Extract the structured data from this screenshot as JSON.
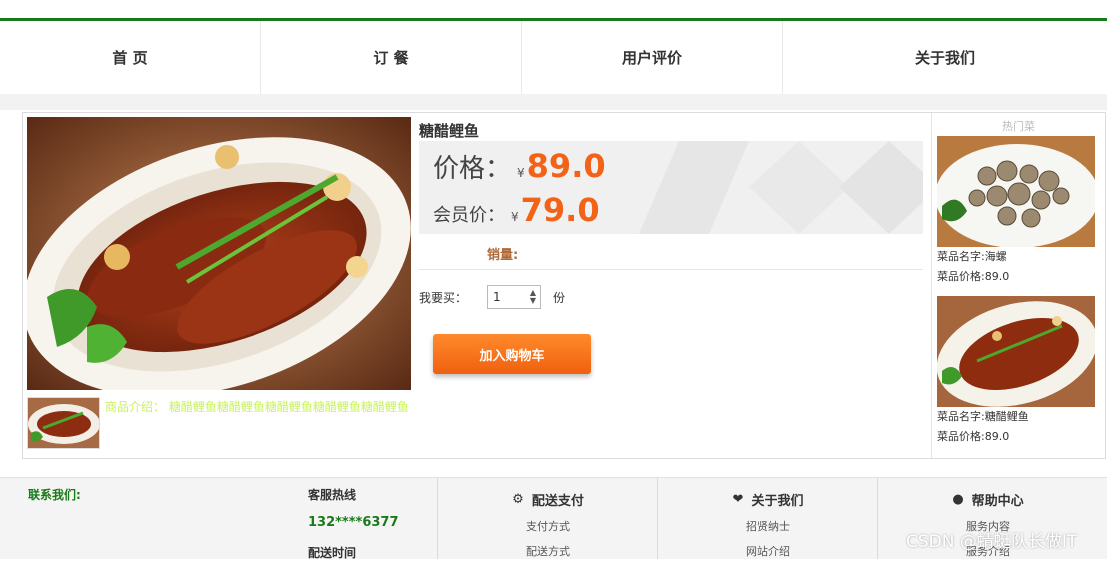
{
  "nav": {
    "items": [
      "首 页",
      "订 餐",
      "用户评价",
      "关于我们"
    ]
  },
  "product": {
    "title": "糖醋鲤鱼",
    "price_label": "价格：",
    "currency": "¥",
    "price": "89.0",
    "member_label": "会员价：",
    "member_price": "79.0",
    "sales_label": "销量:",
    "buy_label": "我要买：",
    "quantity": "1",
    "unit": "份",
    "cart_button": "加入购物车",
    "intro": "商品介绍：  糖醋鲤鱼糖醋鲤鱼糖醋鲤鱼糖醋鲤鱼糖醋鲤鱼"
  },
  "sidebar": {
    "title": "热门菜",
    "items": [
      {
        "name": "菜品名字:海螺",
        "price": "菜品价格:89.0"
      },
      {
        "name": "菜品名字:糖醋鲤鱼",
        "price": "菜品价格:89.0"
      }
    ]
  },
  "footer": {
    "contact": "联系我们:",
    "hotline_label": "客服热线",
    "hotline": "132****6377",
    "delivery_time": "配送时间",
    "col1": {
      "title": "配送支付",
      "links": [
        "支付方式",
        "配送方式"
      ]
    },
    "col2": {
      "title": "关于我们",
      "links": [
        "招贤纳士",
        "网站介绍"
      ]
    },
    "col3": {
      "title": "帮助中心",
      "links": [
        "服务内容",
        "服务介绍"
      ]
    }
  },
  "watermark": "CSDN @蜻蜓队长做IT",
  "colors": {
    "brand_green": "#1a7a1a",
    "price_orange": "#f26318",
    "button_orange": "#f0600f"
  }
}
